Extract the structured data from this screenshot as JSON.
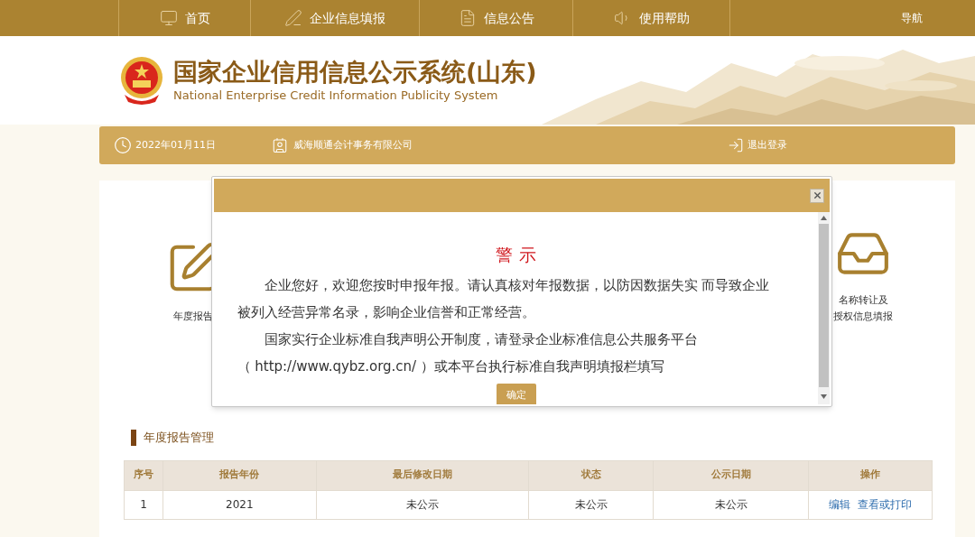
{
  "nav": {
    "items": [
      {
        "label": "首页"
      },
      {
        "label": "企业信息填报"
      },
      {
        "label": "信息公告"
      },
      {
        "label": "使用帮助"
      }
    ],
    "right": "导航"
  },
  "header": {
    "title": "国家企业信用信息公示系统(山东)",
    "subtitle": "National Enterprise Credit Information Publicity System"
  },
  "info_bar": {
    "date": "2022年01月11日",
    "company": "威海顺通会计事务有限公司",
    "logout": "退出登录"
  },
  "cards": [
    {
      "lines": [
        "年度报告"
      ]
    },
    {
      "lines": [
        "名称转让及",
        "授权信息填报"
      ]
    }
  ],
  "section_title": "年度报告管理",
  "table": {
    "columns": [
      "序号",
      "报告年份",
      "最后修改日期",
      "状态",
      "公示日期",
      "操作"
    ],
    "rows": [
      {
        "cells": [
          "1",
          "2021",
          "未公示",
          "未公示",
          "未公示"
        ],
        "actions": [
          "编辑",
          "查看或打印"
        ]
      }
    ]
  },
  "dialog": {
    "title": "警 示",
    "paragraphs": [
      [
        "企业您好，欢迎您按时申报年报。请认真核对年报数据，以防因数据失实 而导致企业",
        "被列入经营异常名录，影响企业信誉和正常经营。"
      ],
      [
        "国家实行企业标准自我声明公开制度，请登录企业标准信息公共服务平台",
        "（ http://www.qybz.org.cn/ ）或本平台执行标准自我声明填报栏填写"
      ]
    ],
    "button": "确定"
  }
}
